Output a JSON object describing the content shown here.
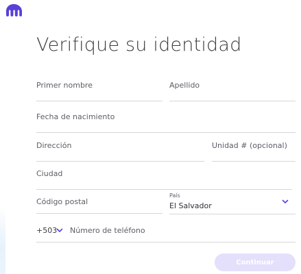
{
  "page": {
    "title": "Verifique su identidad"
  },
  "form": {
    "first_name_placeholder": "Primer nombre",
    "last_name_placeholder": "Apellido",
    "birthdate_placeholder": "Fecha de nacimiento",
    "address_placeholder": "Dirección",
    "unit_placeholder": "Unidad # (opcional)",
    "city_placeholder": "Ciudad",
    "postal_code_placeholder": "Código postal",
    "country_label": "País",
    "country_value": "El Salvador",
    "phone_prefix": "+503",
    "phone_placeholder": "Número de teléfono"
  },
  "actions": {
    "continue_label": "Continuar"
  },
  "colors": {
    "brand": "#5741d9",
    "button_disabled_bg": "#e4e0fb",
    "chevron": "#5741d9"
  },
  "icons": {
    "logo": "kraken-logo-icon",
    "country_dropdown": "chevron-down-icon",
    "phone_prefix_dropdown": "chevron-down-icon"
  }
}
